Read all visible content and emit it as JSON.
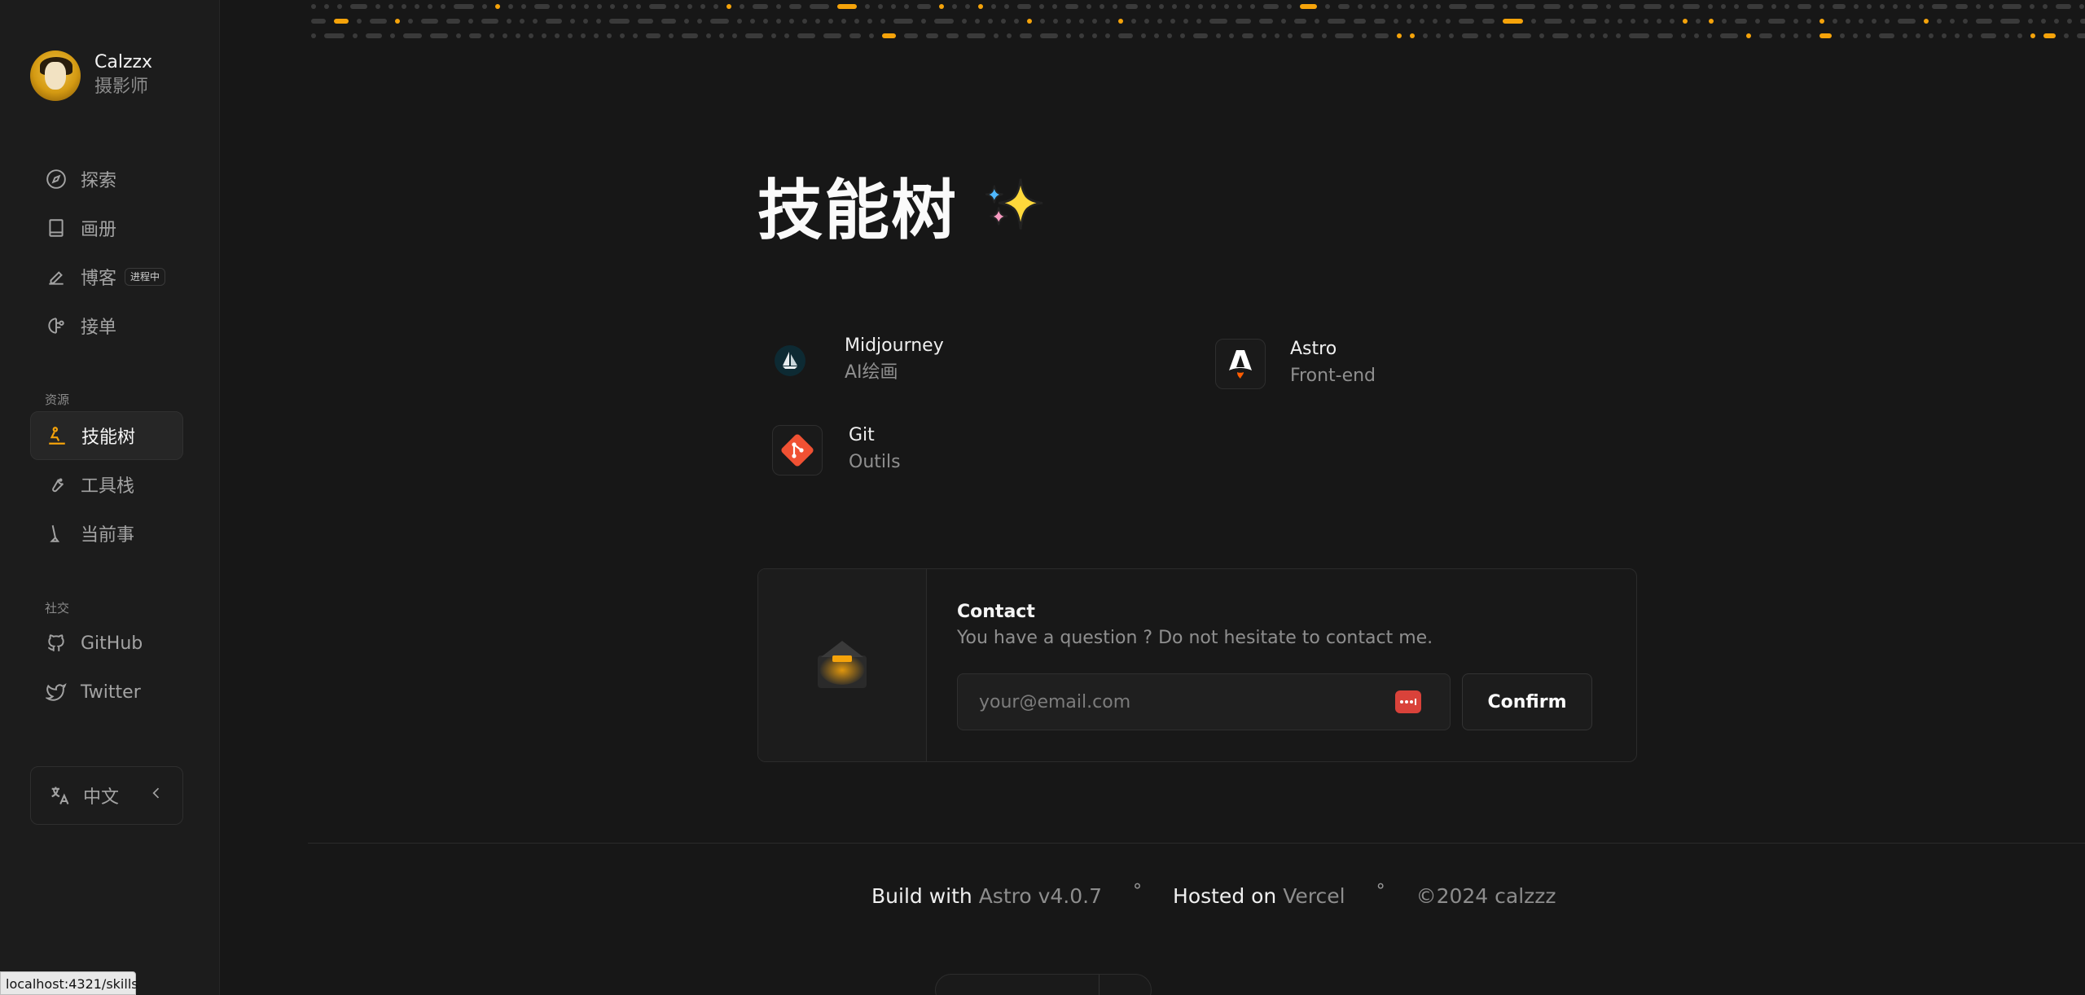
{
  "profile": {
    "name": "Calzzx",
    "role": "摄影师"
  },
  "nav": {
    "main": [
      {
        "label": "探索",
        "icon": "compass-icon"
      },
      {
        "label": "画册",
        "icon": "book-icon"
      },
      {
        "label": "博客",
        "icon": "pen-icon",
        "badge": "进程中"
      },
      {
        "label": "接单",
        "icon": "brain-icon"
      }
    ],
    "resources_label": "资源",
    "resources": [
      {
        "label": "技能树",
        "icon": "skill-icon",
        "active": true
      },
      {
        "label": "工具栈",
        "icon": "wrench-icon"
      },
      {
        "label": "当前事",
        "icon": "broom-icon"
      }
    ],
    "social_label": "社交",
    "social": [
      {
        "label": "GitHub",
        "icon": "github-icon"
      },
      {
        "label": "Twitter",
        "icon": "twitter-icon"
      }
    ]
  },
  "language": {
    "label": "中文"
  },
  "status_url": "localhost:4321/skills",
  "page": {
    "title": "技能树"
  },
  "skills": [
    {
      "name": "Midjourney",
      "desc": "AI绘画",
      "icon": "midjourney-icon"
    },
    {
      "name": "Astro",
      "desc": "Front-end",
      "icon": "astro-icon"
    },
    {
      "name": "Git",
      "desc": "Outils",
      "icon": "git-icon"
    }
  ],
  "contact": {
    "title": "Contact",
    "subtitle": "You have a question ? Do not hesitate to contact me.",
    "placeholder": "your@email.com",
    "button": "Confirm"
  },
  "footer": {
    "build_prefix": "Build with",
    "build_value": "Astro v4.0.7",
    "hosted_prefix": "Hosted on",
    "hosted_value": "Vercel",
    "copyright": "©2024 calzzz",
    "separator": "°"
  },
  "colors": {
    "accent": "#f5a30a",
    "background": "#171717",
    "sidebar": "#1c1c1c"
  }
}
